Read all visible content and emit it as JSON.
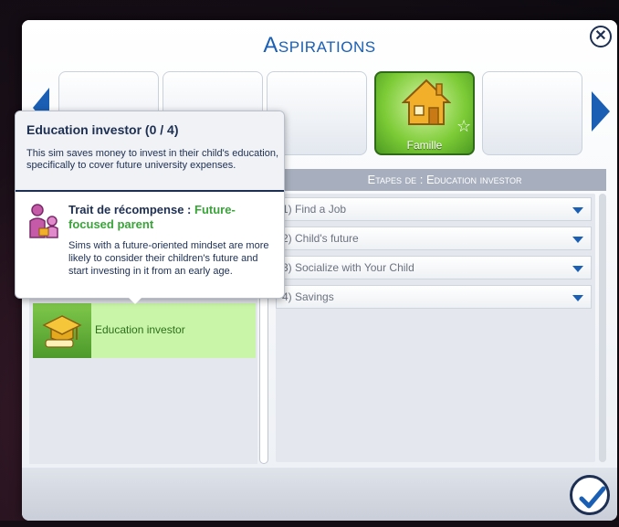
{
  "dialog": {
    "title": "Aspirations",
    "close_glyph": "✕",
    "confirm_icon": "check-icon"
  },
  "categories": {
    "selected": {
      "label": "Famille",
      "icon": "house-icon",
      "badge": "☆"
    }
  },
  "steps": {
    "header": "Etapes de  : Education investor",
    "items": [
      {
        "label": "1) Find a Job"
      },
      {
        "label": "2) Child's future"
      },
      {
        "label": "3) Socialize with Your Child"
      },
      {
        "label": "4) Savings"
      }
    ]
  },
  "aspiration_list": {
    "selected": {
      "label": "Education investor",
      "icon": "graduation-cap-icon"
    }
  },
  "tooltip": {
    "title": "Education investor (0  /  4)",
    "description": "This sim saves money to invest in their child's education, specifically to cover future university expenses.",
    "reward_label": "Trait de récompense  : ",
    "reward_value": "Future-focused parent",
    "reward_icon": "parent-child-icon",
    "reward_description": "Sims with a future-oriented mindset are more likely to consider their children's future and start investing in it from an early age."
  },
  "colors": {
    "accent": "#1a5fb4",
    "selected_green": "#7ccb36",
    "reward_green": "#3aa43a",
    "text_dark": "#1d2f52"
  }
}
